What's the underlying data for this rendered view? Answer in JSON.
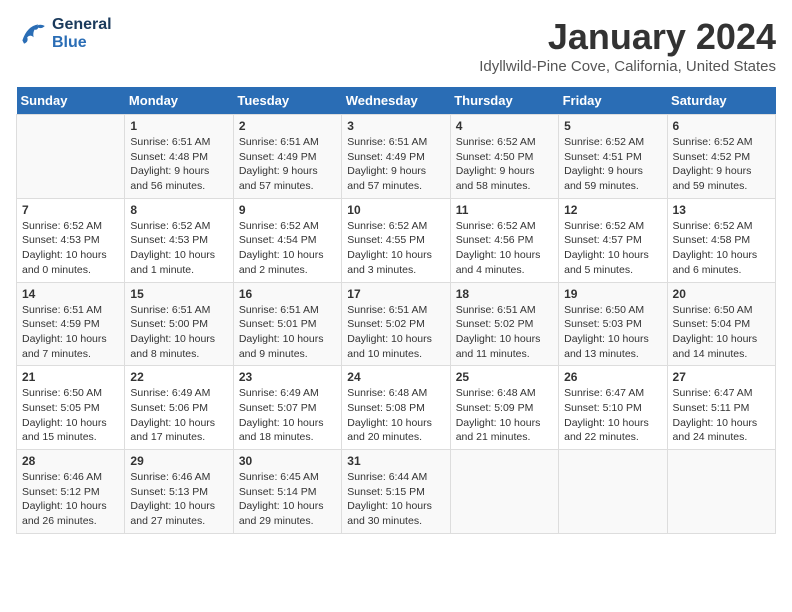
{
  "logo": {
    "line1": "General",
    "line2": "Blue"
  },
  "title": "January 2024",
  "subtitle": "Idyllwild-Pine Cove, California, United States",
  "weekdays": [
    "Sunday",
    "Monday",
    "Tuesday",
    "Wednesday",
    "Thursday",
    "Friday",
    "Saturday"
  ],
  "weeks": [
    [
      {
        "day": "",
        "sunrise": "",
        "sunset": "",
        "daylight": ""
      },
      {
        "day": "1",
        "sunrise": "Sunrise: 6:51 AM",
        "sunset": "Sunset: 4:48 PM",
        "daylight": "Daylight: 9 hours and 56 minutes."
      },
      {
        "day": "2",
        "sunrise": "Sunrise: 6:51 AM",
        "sunset": "Sunset: 4:49 PM",
        "daylight": "Daylight: 9 hours and 57 minutes."
      },
      {
        "day": "3",
        "sunrise": "Sunrise: 6:51 AM",
        "sunset": "Sunset: 4:49 PM",
        "daylight": "Daylight: 9 hours and 57 minutes."
      },
      {
        "day": "4",
        "sunrise": "Sunrise: 6:52 AM",
        "sunset": "Sunset: 4:50 PM",
        "daylight": "Daylight: 9 hours and 58 minutes."
      },
      {
        "day": "5",
        "sunrise": "Sunrise: 6:52 AM",
        "sunset": "Sunset: 4:51 PM",
        "daylight": "Daylight: 9 hours and 59 minutes."
      },
      {
        "day": "6",
        "sunrise": "Sunrise: 6:52 AM",
        "sunset": "Sunset: 4:52 PM",
        "daylight": "Daylight: 9 hours and 59 minutes."
      }
    ],
    [
      {
        "day": "7",
        "sunrise": "Sunrise: 6:52 AM",
        "sunset": "Sunset: 4:53 PM",
        "daylight": "Daylight: 10 hours and 0 minutes."
      },
      {
        "day": "8",
        "sunrise": "Sunrise: 6:52 AM",
        "sunset": "Sunset: 4:53 PM",
        "daylight": "Daylight: 10 hours and 1 minute."
      },
      {
        "day": "9",
        "sunrise": "Sunrise: 6:52 AM",
        "sunset": "Sunset: 4:54 PM",
        "daylight": "Daylight: 10 hours and 2 minutes."
      },
      {
        "day": "10",
        "sunrise": "Sunrise: 6:52 AM",
        "sunset": "Sunset: 4:55 PM",
        "daylight": "Daylight: 10 hours and 3 minutes."
      },
      {
        "day": "11",
        "sunrise": "Sunrise: 6:52 AM",
        "sunset": "Sunset: 4:56 PM",
        "daylight": "Daylight: 10 hours and 4 minutes."
      },
      {
        "day": "12",
        "sunrise": "Sunrise: 6:52 AM",
        "sunset": "Sunset: 4:57 PM",
        "daylight": "Daylight: 10 hours and 5 minutes."
      },
      {
        "day": "13",
        "sunrise": "Sunrise: 6:52 AM",
        "sunset": "Sunset: 4:58 PM",
        "daylight": "Daylight: 10 hours and 6 minutes."
      }
    ],
    [
      {
        "day": "14",
        "sunrise": "Sunrise: 6:51 AM",
        "sunset": "Sunset: 4:59 PM",
        "daylight": "Daylight: 10 hours and 7 minutes."
      },
      {
        "day": "15",
        "sunrise": "Sunrise: 6:51 AM",
        "sunset": "Sunset: 5:00 PM",
        "daylight": "Daylight: 10 hours and 8 minutes."
      },
      {
        "day": "16",
        "sunrise": "Sunrise: 6:51 AM",
        "sunset": "Sunset: 5:01 PM",
        "daylight": "Daylight: 10 hours and 9 minutes."
      },
      {
        "day": "17",
        "sunrise": "Sunrise: 6:51 AM",
        "sunset": "Sunset: 5:02 PM",
        "daylight": "Daylight: 10 hours and 10 minutes."
      },
      {
        "day": "18",
        "sunrise": "Sunrise: 6:51 AM",
        "sunset": "Sunset: 5:02 PM",
        "daylight": "Daylight: 10 hours and 11 minutes."
      },
      {
        "day": "19",
        "sunrise": "Sunrise: 6:50 AM",
        "sunset": "Sunset: 5:03 PM",
        "daylight": "Daylight: 10 hours and 13 minutes."
      },
      {
        "day": "20",
        "sunrise": "Sunrise: 6:50 AM",
        "sunset": "Sunset: 5:04 PM",
        "daylight": "Daylight: 10 hours and 14 minutes."
      }
    ],
    [
      {
        "day": "21",
        "sunrise": "Sunrise: 6:50 AM",
        "sunset": "Sunset: 5:05 PM",
        "daylight": "Daylight: 10 hours and 15 minutes."
      },
      {
        "day": "22",
        "sunrise": "Sunrise: 6:49 AM",
        "sunset": "Sunset: 5:06 PM",
        "daylight": "Daylight: 10 hours and 17 minutes."
      },
      {
        "day": "23",
        "sunrise": "Sunrise: 6:49 AM",
        "sunset": "Sunset: 5:07 PM",
        "daylight": "Daylight: 10 hours and 18 minutes."
      },
      {
        "day": "24",
        "sunrise": "Sunrise: 6:48 AM",
        "sunset": "Sunset: 5:08 PM",
        "daylight": "Daylight: 10 hours and 20 minutes."
      },
      {
        "day": "25",
        "sunrise": "Sunrise: 6:48 AM",
        "sunset": "Sunset: 5:09 PM",
        "daylight": "Daylight: 10 hours and 21 minutes."
      },
      {
        "day": "26",
        "sunrise": "Sunrise: 6:47 AM",
        "sunset": "Sunset: 5:10 PM",
        "daylight": "Daylight: 10 hours and 22 minutes."
      },
      {
        "day": "27",
        "sunrise": "Sunrise: 6:47 AM",
        "sunset": "Sunset: 5:11 PM",
        "daylight": "Daylight: 10 hours and 24 minutes."
      }
    ],
    [
      {
        "day": "28",
        "sunrise": "Sunrise: 6:46 AM",
        "sunset": "Sunset: 5:12 PM",
        "daylight": "Daylight: 10 hours and 26 minutes."
      },
      {
        "day": "29",
        "sunrise": "Sunrise: 6:46 AM",
        "sunset": "Sunset: 5:13 PM",
        "daylight": "Daylight: 10 hours and 27 minutes."
      },
      {
        "day": "30",
        "sunrise": "Sunrise: 6:45 AM",
        "sunset": "Sunset: 5:14 PM",
        "daylight": "Daylight: 10 hours and 29 minutes."
      },
      {
        "day": "31",
        "sunrise": "Sunrise: 6:44 AM",
        "sunset": "Sunset: 5:15 PM",
        "daylight": "Daylight: 10 hours and 30 minutes."
      },
      {
        "day": "",
        "sunrise": "",
        "sunset": "",
        "daylight": ""
      },
      {
        "day": "",
        "sunrise": "",
        "sunset": "",
        "daylight": ""
      },
      {
        "day": "",
        "sunrise": "",
        "sunset": "",
        "daylight": ""
      }
    ]
  ]
}
